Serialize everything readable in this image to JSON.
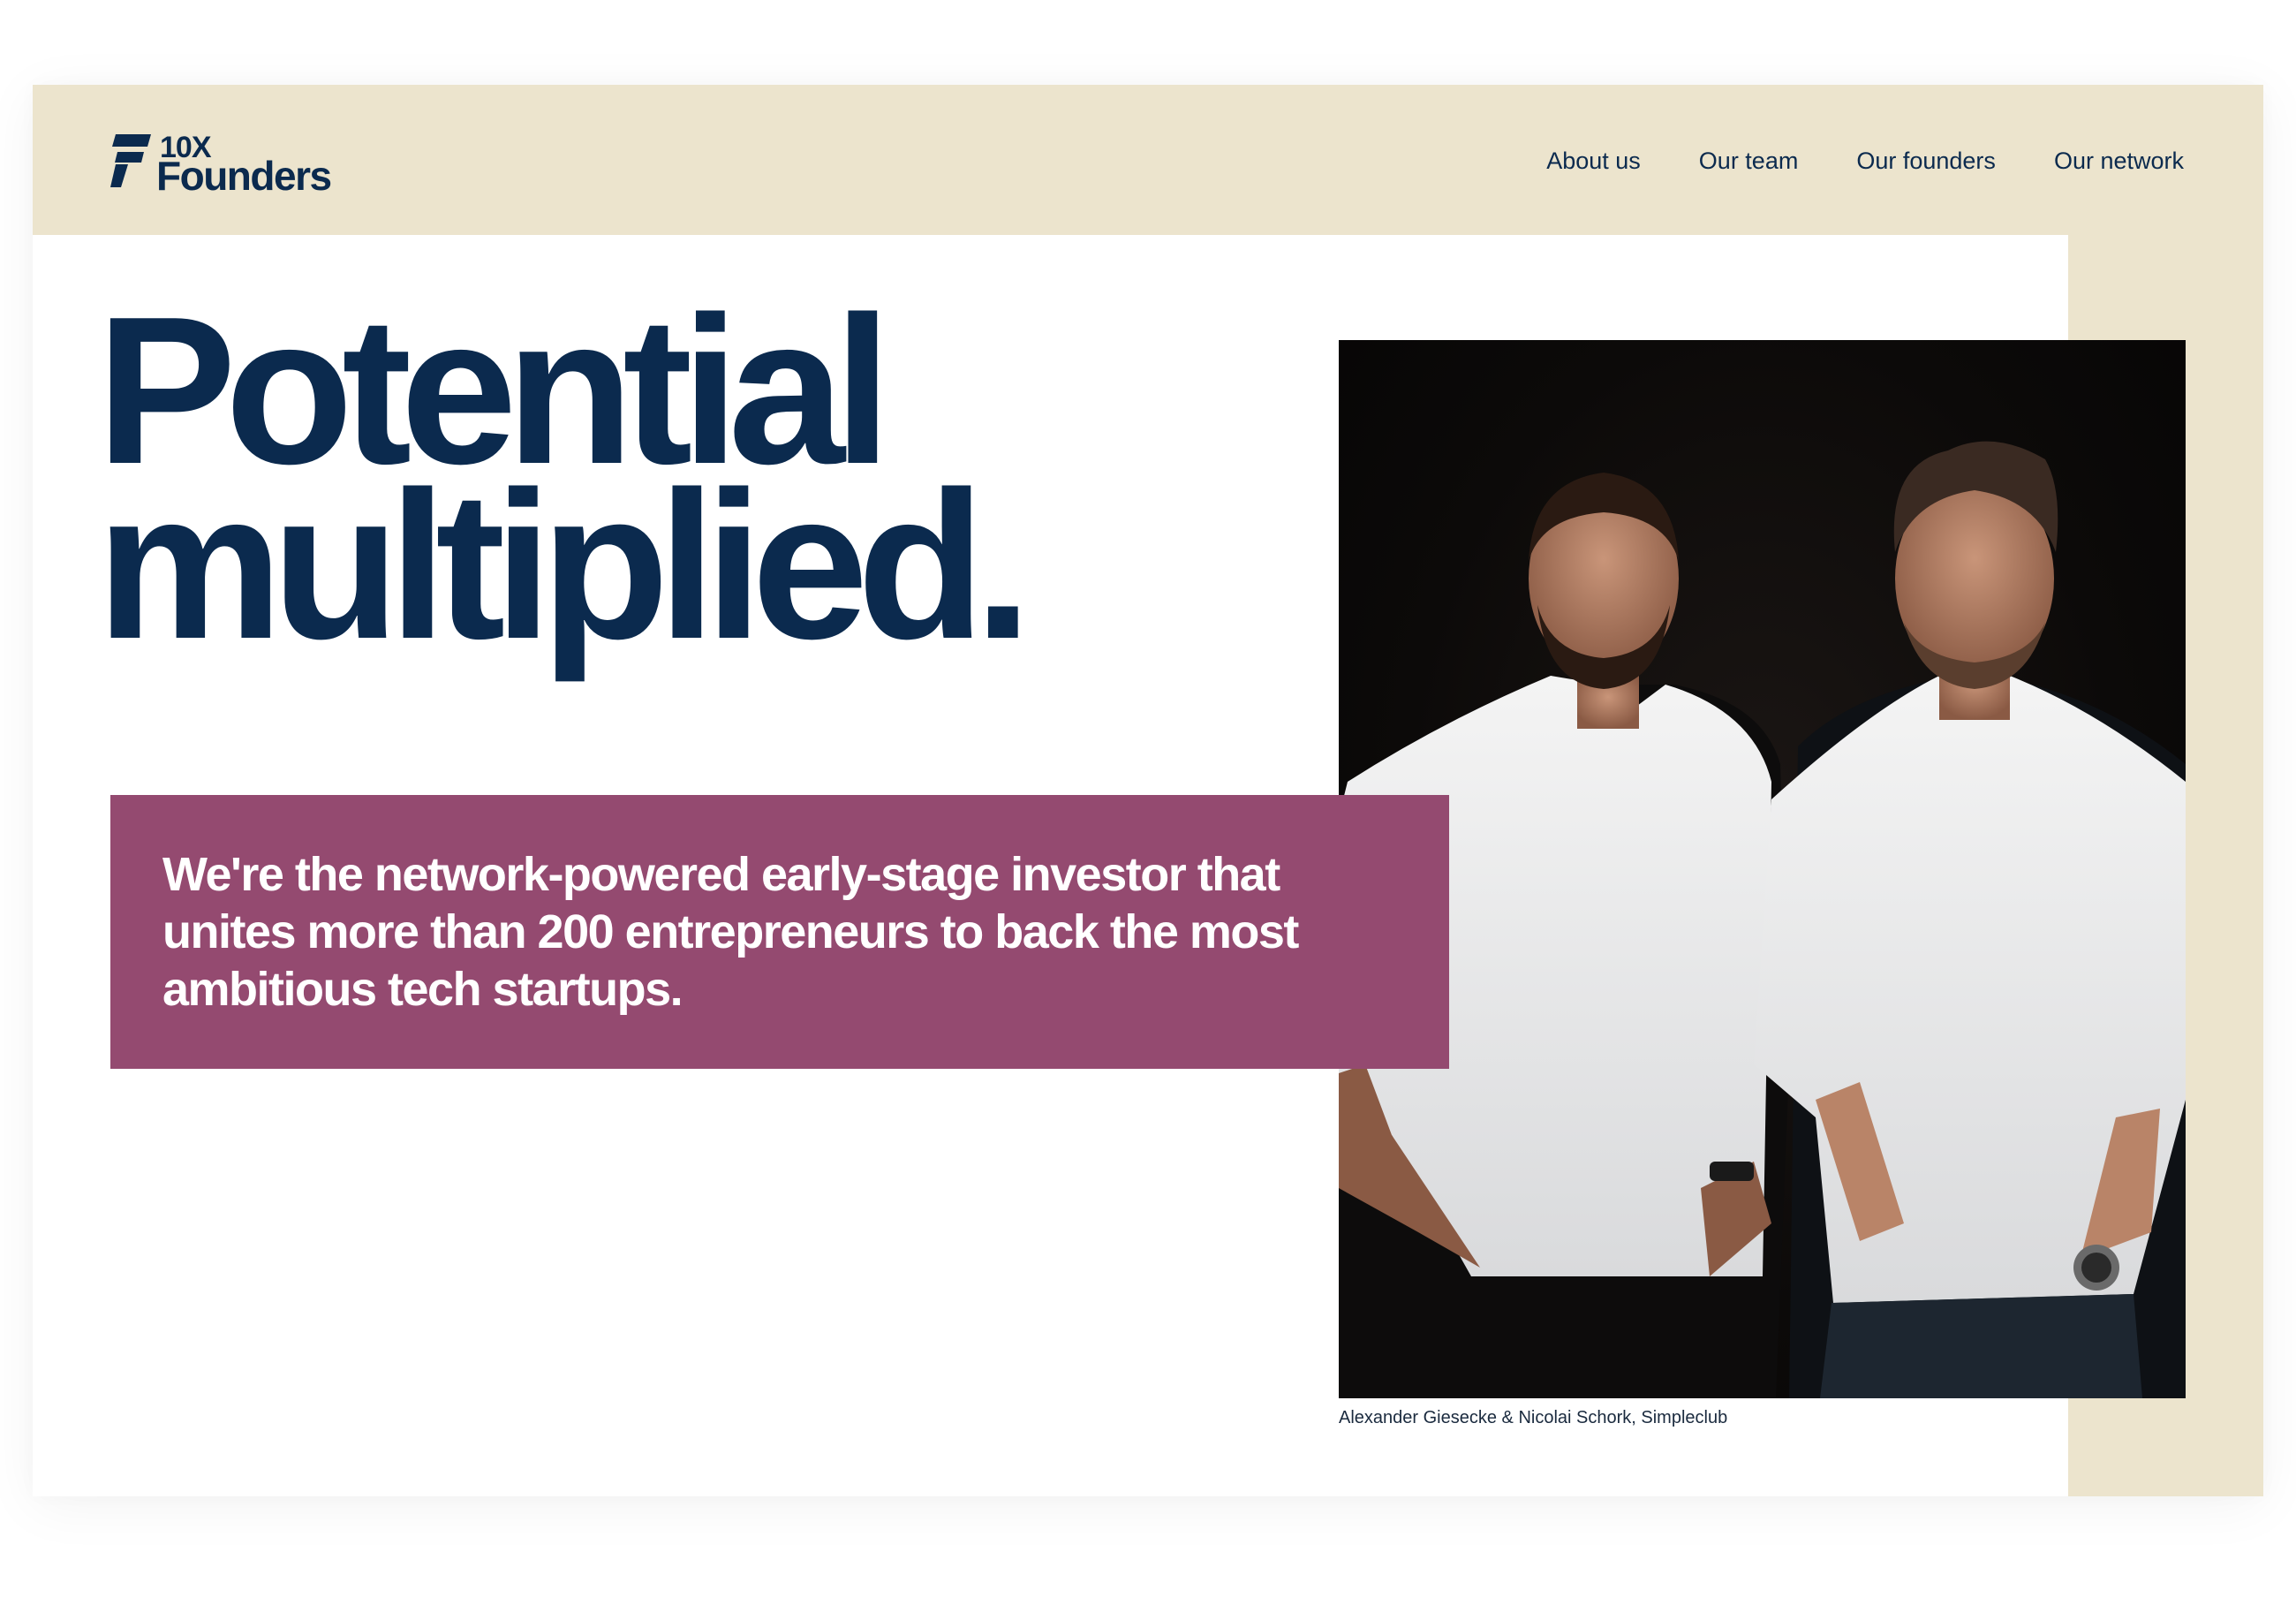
{
  "brand": {
    "logo_number": "10X",
    "logo_word": "Founders",
    "colors": {
      "navy": "#0b2a4e",
      "beige": "#ece4cd",
      "plum": "#944a70",
      "white": "#ffffff"
    }
  },
  "nav": {
    "items": [
      {
        "label": "About us"
      },
      {
        "label": "Our team"
      },
      {
        "label": "Our founders"
      },
      {
        "label": "Our network"
      }
    ]
  },
  "hero": {
    "headline_line1": "Potential",
    "headline_line2": "multiplied.",
    "intro": "We're the network-powered early-stage investor that unites more than 200 entrepreneurs to back the most ambitious tech startups.",
    "caption": "Alexander Giesecke & Nicolai Schork, Simpleclub"
  }
}
